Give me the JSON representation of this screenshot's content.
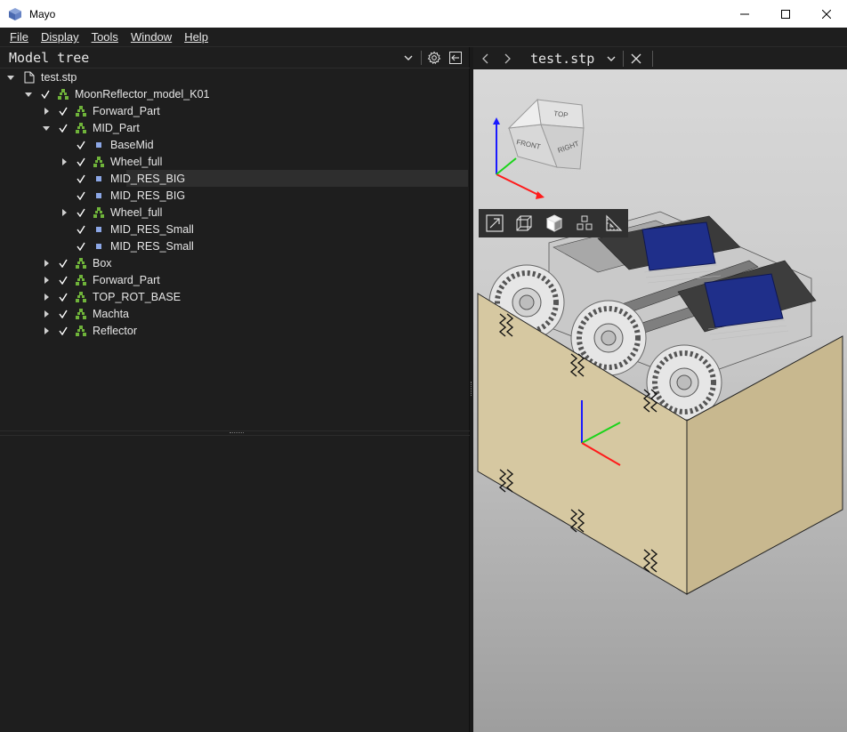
{
  "window": {
    "title": "Mayo"
  },
  "menu": [
    "File",
    "Display",
    "Tools",
    "Window",
    "Help"
  ],
  "model_tree": {
    "title": "Model tree",
    "rows": [
      {
        "label": "test.stp",
        "depth": 0,
        "arrow": "expanded",
        "checked": false,
        "icon": "file-icon"
      },
      {
        "label": "MoonReflector_model_K01",
        "depth": 1,
        "arrow": "expanded",
        "checked": true,
        "icon": "assembly-icon"
      },
      {
        "label": "Forward_Part",
        "depth": 2,
        "arrow": "collapsed",
        "checked": true,
        "icon": "assembly-icon"
      },
      {
        "label": "MID_Part",
        "depth": 2,
        "arrow": "expanded",
        "checked": true,
        "icon": "assembly-icon"
      },
      {
        "label": "BaseMid",
        "depth": 3,
        "arrow": "none",
        "checked": true,
        "icon": "part-icon"
      },
      {
        "label": "Wheel_full",
        "depth": 3,
        "arrow": "collapsed",
        "checked": true,
        "icon": "assembly-icon"
      },
      {
        "label": "MID_RES_BIG",
        "depth": 3,
        "arrow": "none",
        "checked": true,
        "icon": "part-icon",
        "selected": true
      },
      {
        "label": "MID_RES_BIG",
        "depth": 3,
        "arrow": "none",
        "checked": true,
        "icon": "part-icon"
      },
      {
        "label": "Wheel_full",
        "depth": 3,
        "arrow": "collapsed",
        "checked": true,
        "icon": "assembly-icon"
      },
      {
        "label": "MID_RES_Small",
        "depth": 3,
        "arrow": "none",
        "checked": true,
        "icon": "part-icon"
      },
      {
        "label": "MID_RES_Small",
        "depth": 3,
        "arrow": "none",
        "checked": true,
        "icon": "part-icon"
      },
      {
        "label": "Box",
        "depth": 2,
        "arrow": "collapsed",
        "checked": true,
        "icon": "assembly-icon"
      },
      {
        "label": "Forward_Part",
        "depth": 2,
        "arrow": "collapsed",
        "checked": true,
        "icon": "assembly-icon"
      },
      {
        "label": "TOP_ROT_BASE",
        "depth": 2,
        "arrow": "collapsed",
        "checked": true,
        "icon": "assembly-icon"
      },
      {
        "label": "Machta",
        "depth": 2,
        "arrow": "collapsed",
        "checked": true,
        "icon": "assembly-icon"
      },
      {
        "label": "Reflector",
        "depth": 2,
        "arrow": "collapsed",
        "checked": true,
        "icon": "assembly-icon"
      }
    ]
  },
  "document": {
    "name": "test.stp"
  },
  "view_cube": {
    "top": "TOP",
    "front": "FRONT",
    "right": "RIGHT"
  },
  "view_tools": [
    "fit-all-icon",
    "wireframe-icon",
    "shaded-icon",
    "explode-icon",
    "measure-icon"
  ],
  "colors": {
    "background": "#1e1e1e",
    "assembly_icon": "#6fb33a",
    "part_icon": "#8ca7e6",
    "panel": "#d6c8a1"
  }
}
